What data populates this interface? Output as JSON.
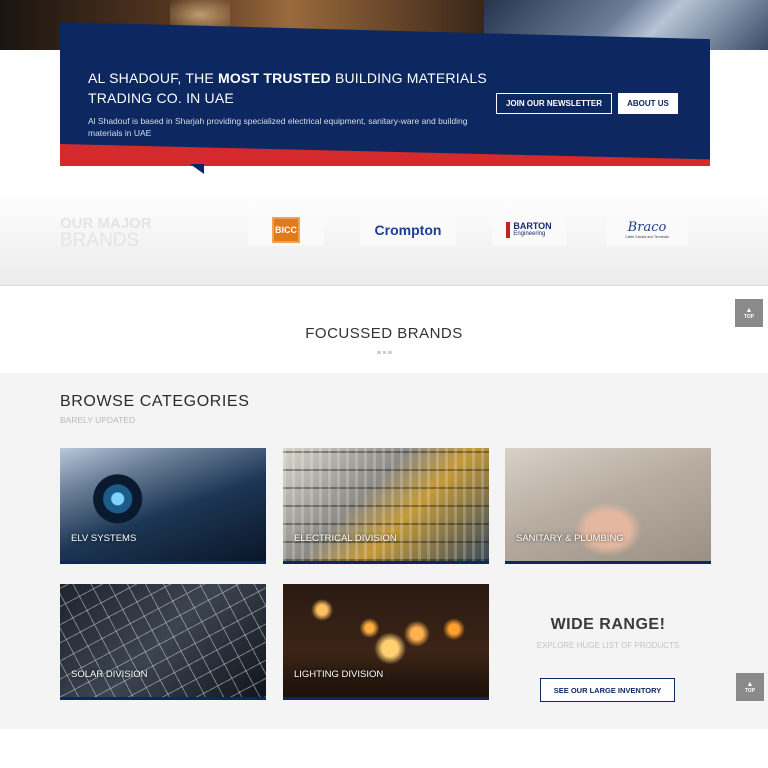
{
  "banner": {
    "heading_prefix": "AL SHADOUF, THE ",
    "heading_bold": "MOST TRUSTED",
    "heading_suffix": " BUILDING MATERIALS TRADING CO. IN UAE",
    "description": "Al Shadouf is based in Sharjah providing specialized electrical equipment, sanitary-ware and building materials in UAE",
    "newsletter_button": "JOIN OUR NEWSLETTER",
    "about_button": "ABOUT US"
  },
  "brands": {
    "title_line1": "OUR MAJOR",
    "title_line2": "BRANDS",
    "logos": {
      "bicc": "BICC",
      "crompton": "Crompton",
      "barton": "BARTON",
      "barton_sub": "Engineering",
      "braco": "Braco",
      "braco_sub": "Cable Glands and Terminals"
    }
  },
  "focussed_brands": {
    "title": "FOCUSSED BRANDS"
  },
  "categories": {
    "title": "BROWSE CATEGORIES",
    "subtitle": "BARELY UPDATED",
    "items": [
      {
        "label": "ELV SYSTEMS"
      },
      {
        "label": "ELECTRICAL DIVISION"
      },
      {
        "label": "SANITARY & PLUMBING"
      },
      {
        "label": "SOLAR DIVISION"
      },
      {
        "label": "LIGHTING DIVISION"
      }
    ],
    "range": {
      "title": "WIDE RANGE!",
      "subtitle": "EXPLORE HUGE LIST OF PRODUCTS",
      "button": "SEE OUR LARGE INVENTORY"
    }
  },
  "scroll_top": {
    "label": "TOP",
    "icon": "chevron-up-icon"
  },
  "colors": {
    "navy": "#0d2860",
    "red": "#d42a2e"
  }
}
